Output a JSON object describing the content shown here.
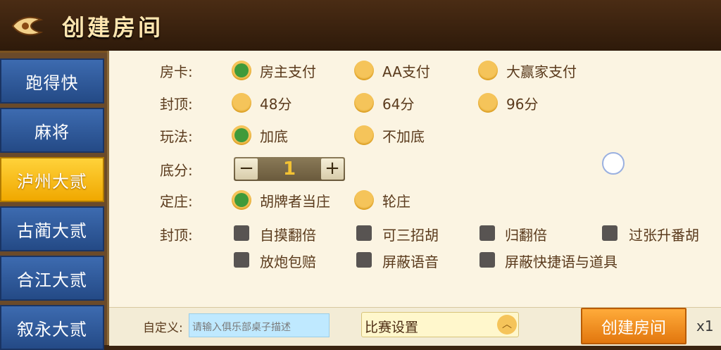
{
  "header": {
    "title": "创建房间",
    "back_icon": "back-arrow-icon"
  },
  "sidebar": {
    "items": [
      {
        "label": "跑得快",
        "active": false
      },
      {
        "label": "麻将",
        "active": false
      },
      {
        "label": "泸州大贰",
        "active": true
      },
      {
        "label": "古蔺大贰",
        "active": false
      },
      {
        "label": "合江大贰",
        "active": false
      },
      {
        "label": "叙永大贰",
        "active": false
      }
    ]
  },
  "settings": {
    "room_card": {
      "label": "房卡:",
      "options": [
        "房主支付",
        "AA支付",
        "大赢家支付"
      ],
      "selected": 0
    },
    "cap": {
      "label": "封顶:",
      "options": [
        "48分",
        "64分",
        "96分"
      ],
      "selected": -1
    },
    "play": {
      "label": "玩法:",
      "options": [
        "加底",
        "不加底"
      ],
      "selected": 0
    },
    "base": {
      "label": "底分:",
      "minus": "−",
      "value": "1",
      "plus": "+"
    },
    "banker": {
      "label": "定庄:",
      "options": [
        "胡牌者当庄",
        "轮庄"
      ],
      "selected": 0
    },
    "extras": {
      "label": "封顶:",
      "options": [
        "自摸翻倍",
        "可三招胡",
        "归翻倍",
        "过张升番胡",
        "放炮包赔",
        "屏蔽语音",
        "屏蔽快捷语与道具"
      ]
    }
  },
  "footer": {
    "custom_label": "自定义:",
    "custom_placeholder": "请输入俱乐部桌子描述",
    "match_label": "比赛设置",
    "create_label": "创建房间",
    "multiplier": "x1"
  },
  "colors": {
    "accent": "#f0a800",
    "selected_radio": "#3f9a3a",
    "radio": "#f5c45a",
    "tab": "#2f5a9e"
  }
}
